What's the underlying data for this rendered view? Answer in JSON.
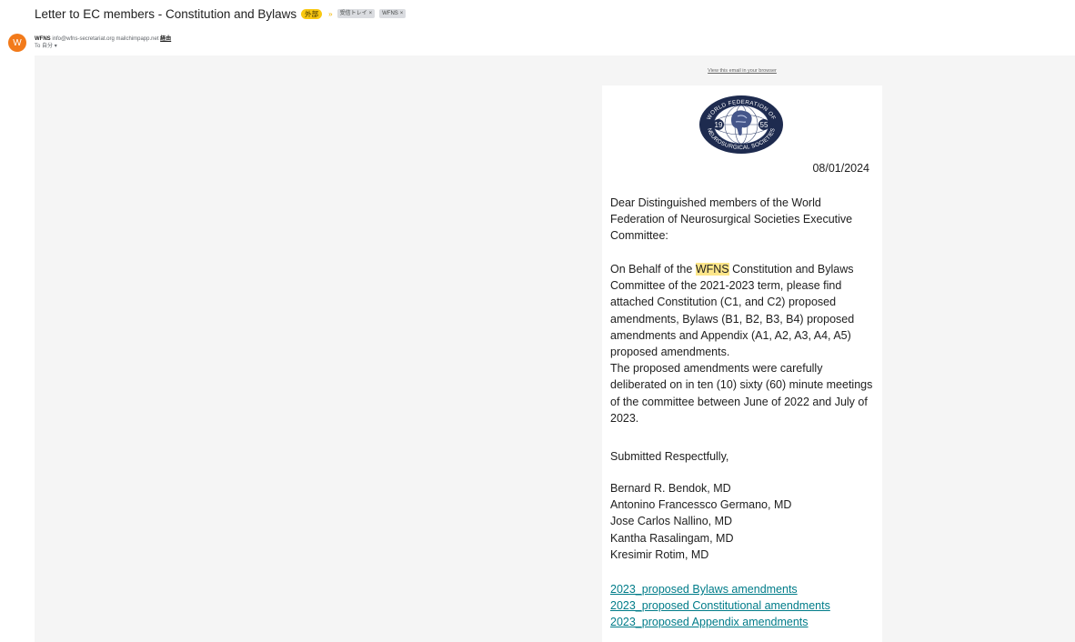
{
  "email": {
    "subject": "Letter to EC members - Constitution and Bylaws",
    "external_badge": "外部",
    "importance_marker": "»",
    "labels": [
      {
        "name": "受信トレイ",
        "remove": "×"
      },
      {
        "name": "WFNS",
        "remove": "×"
      }
    ],
    "sender": {
      "avatar_letter": "W",
      "name": "WFNS",
      "address": "info@wfns-secretariat.org",
      "via_domain": "mailchimpapp.net",
      "via_label": "経由",
      "to_line": "To 自分",
      "to_dropdown_icon": "caret-down-icon"
    }
  },
  "newsletter": {
    "view_in_browser": "View this email in your browser",
    "logo": {
      "alt": "World Federation of Neurosurgical Societies logo",
      "ring_text": "WORLD FEDERATION OF NEUROSURGICAL SOCIETIES",
      "year_left": "19",
      "year_right": "55"
    },
    "date": "08/01/2024",
    "greeting": "Dear Distinguished members of the World Federation of Neurosurgical Societies Executive Committee:",
    "body_p1_before": "On Behalf of the ",
    "body_p1_highlight": "WFNS",
    "body_p1_after": " Constitution and Bylaws Committee of the 2021-2023 term, please find attached Constitution (C1, and C2) proposed amendments, Bylaws (B1, B2, B3, B4) proposed amendments and Appendix (A1, A2, A3, A4, A5) proposed amendments.",
    "body_p2": "The proposed amendments were carefully deliberated on in ten (10) sixty (60) minute meetings of the committee between June of 2022 and July of 2023.",
    "closing": "Submitted Respectfully,",
    "signatories": [
      "Bernard R. Bendok, MD",
      "Antonino Francessco Germano, MD",
      "Jose Carlos Nallino, MD",
      "Kantha Rasalingam, MD",
      "Kresimir Rotim, MD"
    ],
    "attachments": [
      "2023_proposed Bylaws amendments",
      "2023_proposed Constitutional amendments",
      "2023_proposed Appendix amendments"
    ]
  },
  "colors": {
    "avatar": "#f27a1a",
    "external_badge": "#f9c811",
    "link": "#007c89",
    "highlight": "#fde68a",
    "logo_navy": "#1e2b4f"
  }
}
